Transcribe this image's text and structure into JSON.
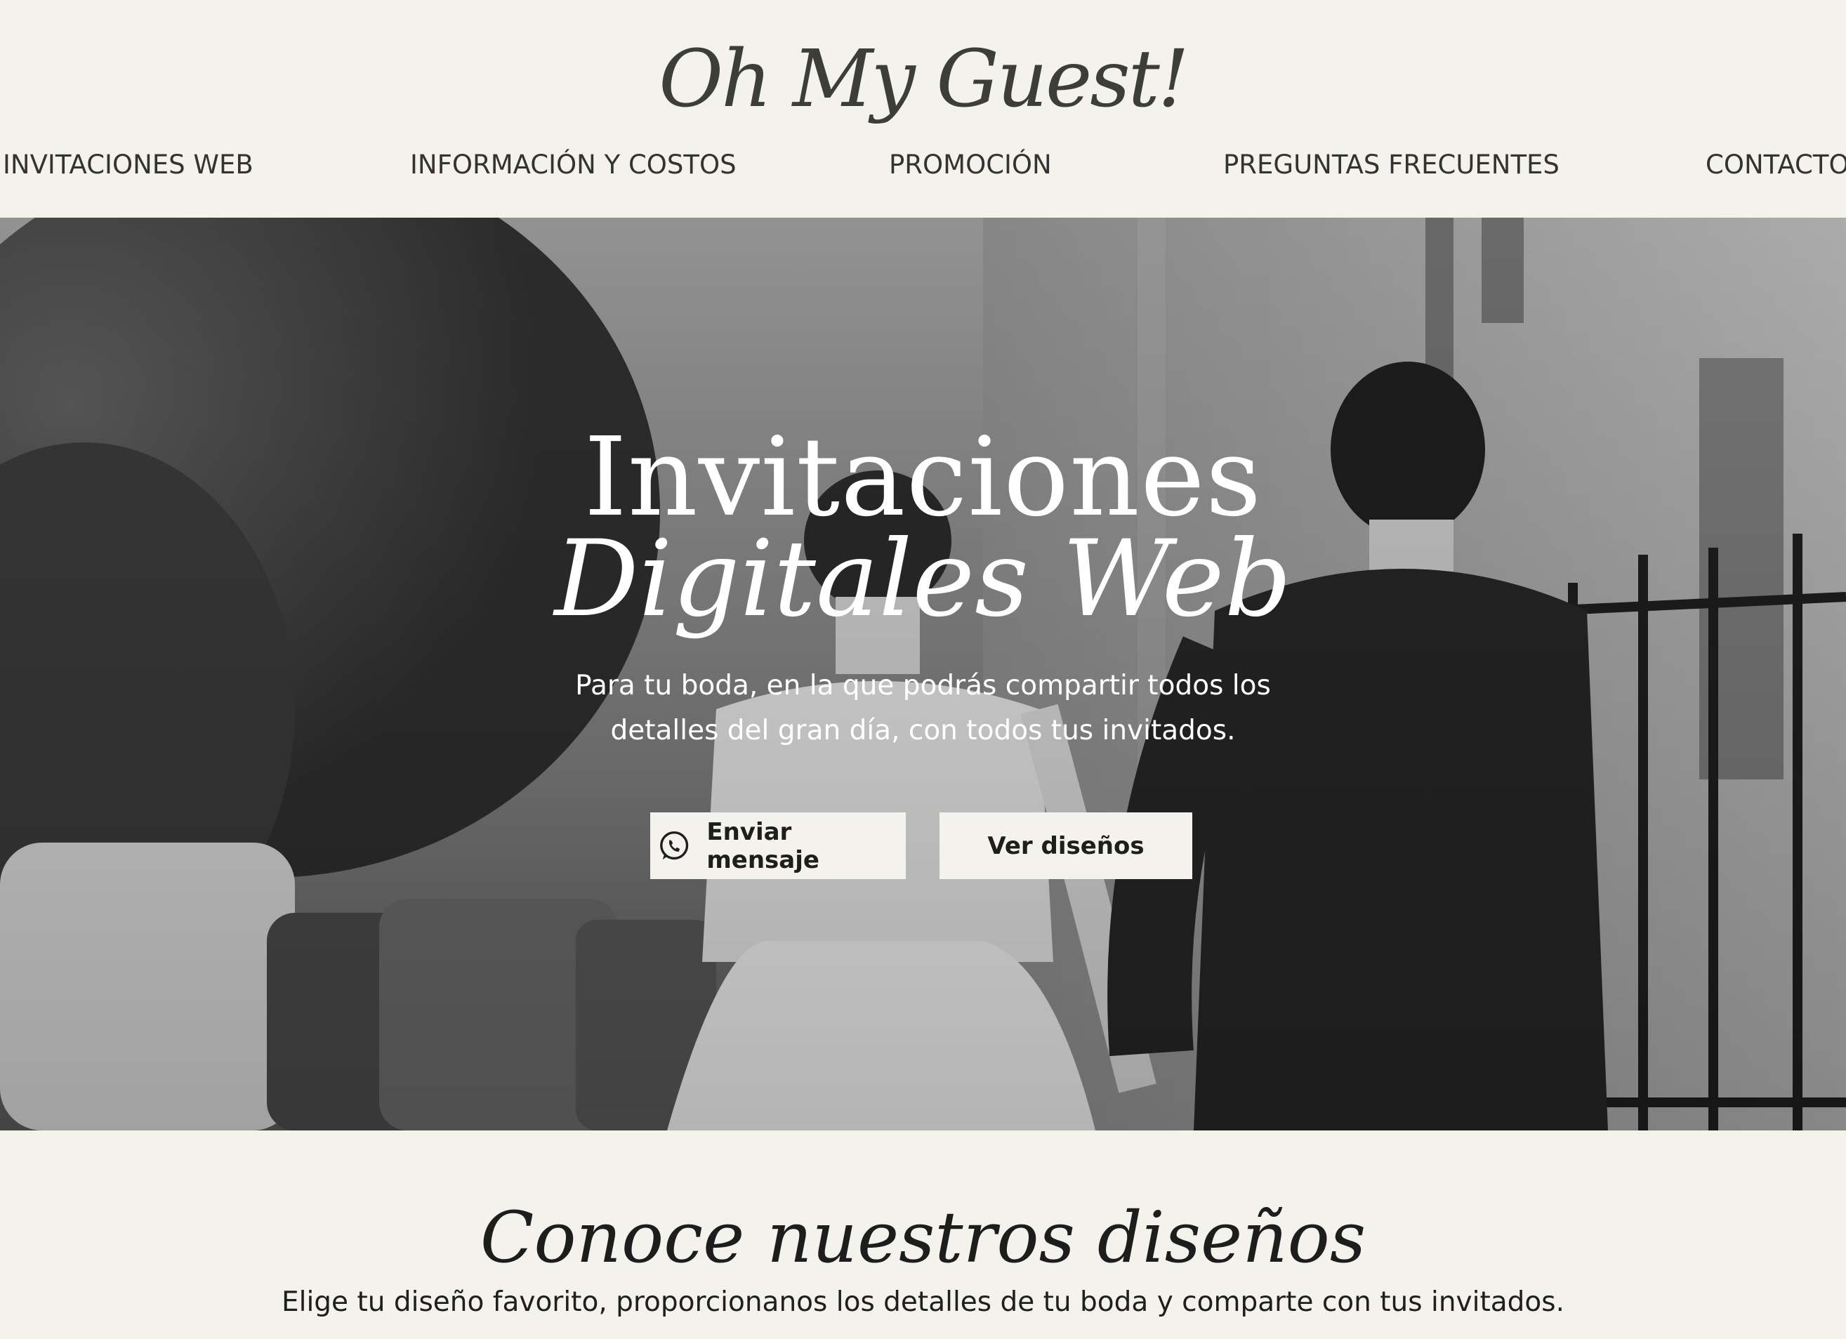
{
  "brand": {
    "logo_text": "Oh My Guest!"
  },
  "nav": {
    "items": [
      {
        "label": "INVITACIONES WEB"
      },
      {
        "label": "INFORMACIÓN Y COSTOS"
      },
      {
        "label": "PROMOCIÓN"
      },
      {
        "label": "PREGUNTAS FRECUENTES"
      },
      {
        "label": "CONTACTO"
      }
    ]
  },
  "hero": {
    "title_line1": "Invitaciones",
    "title_line2": "Digitales Web",
    "subtitle_line1": "Para tu boda, en la que podrás compartir todos los",
    "subtitle_line2": "detalles del gran día, con todos tus invitados.",
    "primary_button": {
      "label": "Enviar mensaje",
      "icon": "whatsapp-icon"
    },
    "secondary_button": {
      "label": "Ver diseños"
    }
  },
  "designs_section": {
    "title": "Conoce nuestros diseños",
    "subtitle": "Elige tu diseño favorito, proporcionanos los detalles de tu boda y comparte con tus invitados."
  },
  "colors": {
    "background": "#f4f2ed",
    "text_dark": "#2b2b2b",
    "hero_text": "#ffffff",
    "button_background": "#f4f2ed"
  }
}
